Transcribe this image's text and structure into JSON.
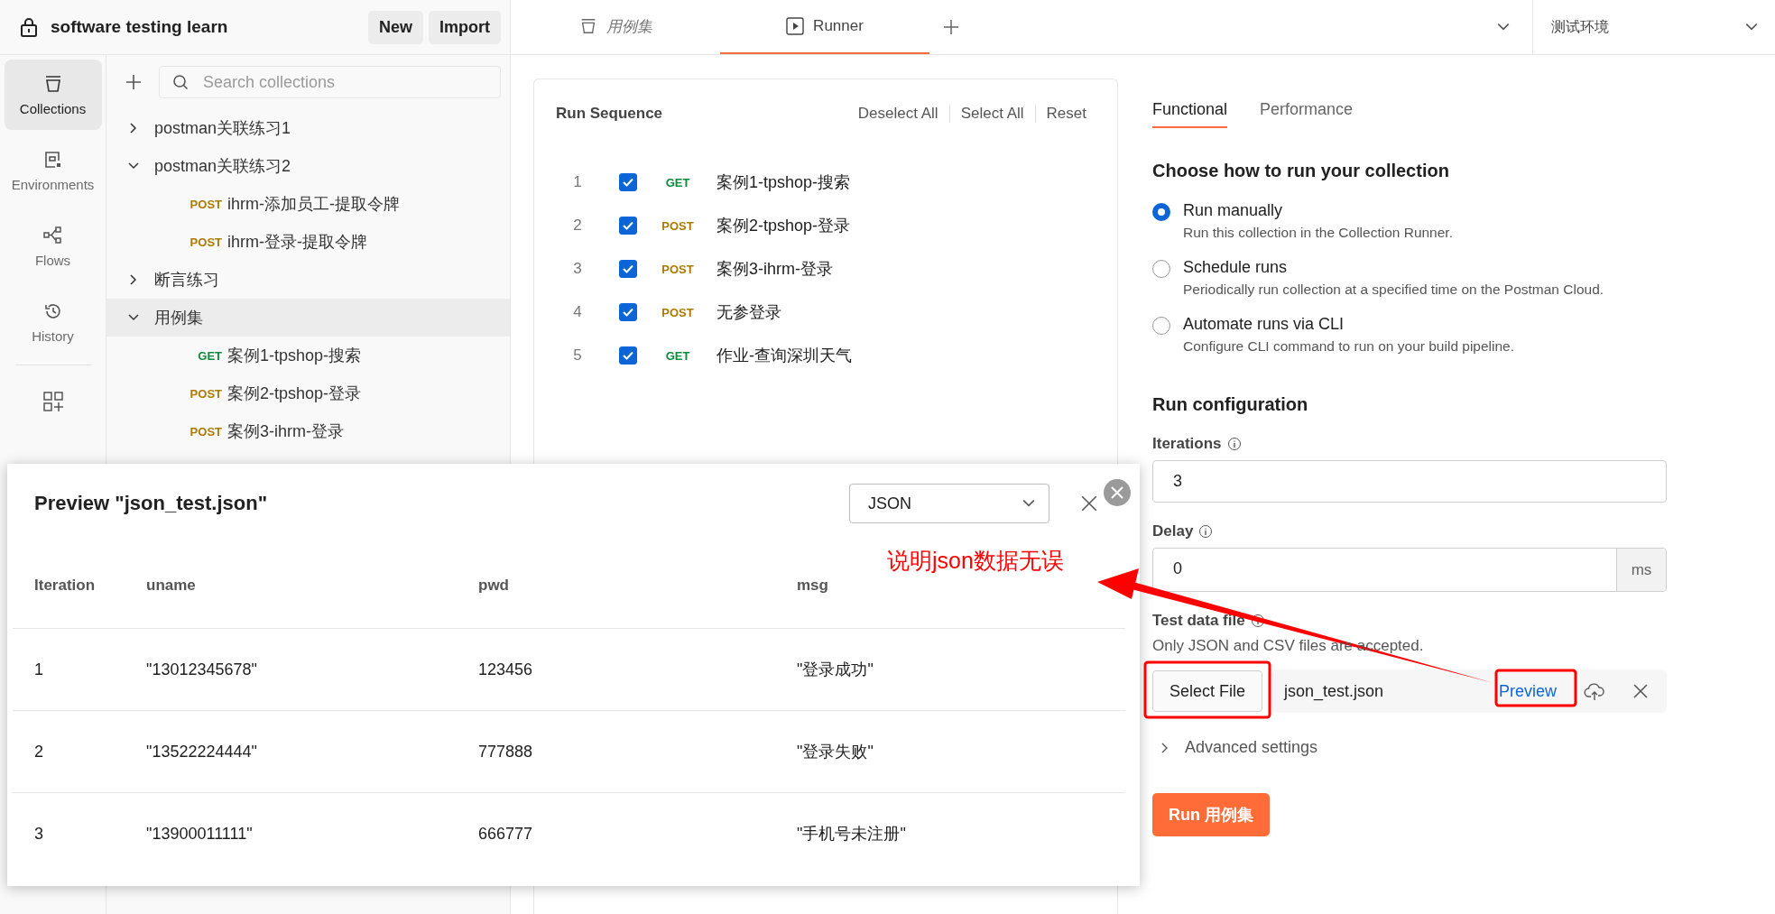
{
  "workspace": {
    "title": "software testing learn",
    "buttons": [
      "New",
      "Import"
    ]
  },
  "nav_rail": [
    {
      "label": "Collections",
      "kind": "collections",
      "selected": true
    },
    {
      "label": "Environments",
      "kind": "environments",
      "selected": false
    },
    {
      "label": "Flows",
      "kind": "flows",
      "selected": false
    },
    {
      "label": "History",
      "kind": "history",
      "selected": false
    }
  ],
  "sidebar": {
    "search": {
      "placeholder": "Search collections"
    },
    "tree": [
      {
        "name": "postman关联练习1",
        "expanded": false,
        "selected": false
      },
      {
        "name": "postman关联练习2",
        "expanded": true,
        "selected": false,
        "children": [
          {
            "method": "POST",
            "name": "ihrm-添加员工-提取令牌"
          },
          {
            "method": "POST",
            "name": "ihrm-登录-提取令牌"
          }
        ]
      },
      {
        "name": "断言练习",
        "expanded": false,
        "selected": false
      },
      {
        "name": "用例集",
        "expanded": true,
        "selected": true,
        "children": [
          {
            "method": "GET",
            "name": "案例1-tpshop-搜索"
          },
          {
            "method": "POST",
            "name": "案例2-tpshop-登录"
          },
          {
            "method": "POST",
            "name": "案例3-ihrm-登录"
          }
        ]
      }
    ]
  },
  "tabs": [
    {
      "label": "用例集",
      "kind": "collection",
      "selected": false
    },
    {
      "label": "Runner",
      "kind": "runner",
      "selected": true
    }
  ],
  "environment": "测试环境",
  "run_sequence": {
    "title": "Run Sequence",
    "actions": [
      "Deselect All",
      "Select All",
      "Reset"
    ],
    "items": [
      {
        "index": "1",
        "checked": true,
        "method": "GET",
        "name": "案例1-tpshop-搜索"
      },
      {
        "index": "2",
        "checked": true,
        "method": "POST",
        "name": "案例2-tpshop-登录"
      },
      {
        "index": "3",
        "checked": true,
        "method": "POST",
        "name": "案例3-ihrm-登录"
      },
      {
        "index": "4",
        "checked": true,
        "method": "POST",
        "name": "无参登录"
      },
      {
        "index": "5",
        "checked": true,
        "method": "GET",
        "name": "作业-查询深圳天气"
      }
    ]
  },
  "config": {
    "tabs": [
      {
        "label": "Functional",
        "selected": true
      },
      {
        "label": "Performance",
        "selected": false
      }
    ],
    "heading": "Choose how to run your collection",
    "run_modes": [
      {
        "label": "Run manually",
        "description": "Run this collection in the Collection Runner.",
        "selected": true
      },
      {
        "label": "Schedule runs",
        "description": "Periodically run collection at a specified time on the Postman Cloud.",
        "selected": false
      },
      {
        "label": "Automate runs via CLI",
        "description": "Configure CLI command to run on your build pipeline.",
        "selected": false
      }
    ],
    "section": "Run configuration",
    "iterations": {
      "label": "Iterations",
      "value": "3"
    },
    "delay": {
      "label": "Delay",
      "value": "0",
      "unit": "ms"
    },
    "test_data": {
      "label": "Test data file",
      "hint": "Only JSON and CSV files are accepted.",
      "button": "Select File",
      "file_name": "json_test.json",
      "preview": "Preview"
    },
    "advanced": "Advanced settings",
    "run_button": "Run 用例集"
  },
  "preview_modal": {
    "title": "Preview \"json_test.json\"",
    "format": "JSON",
    "columns": [
      "Iteration",
      "uname",
      "pwd",
      "msg"
    ],
    "rows": [
      [
        "1",
        "\"13012345678\"",
        "123456",
        "\"登录成功\""
      ],
      [
        "2",
        "\"13522224444\"",
        "777888",
        "\"登录失败\""
      ],
      [
        "3",
        "\"13900011111\"",
        "666777",
        "\"手机号未注册\""
      ]
    ]
  },
  "annotation": {
    "text": "说明json数据无误"
  }
}
